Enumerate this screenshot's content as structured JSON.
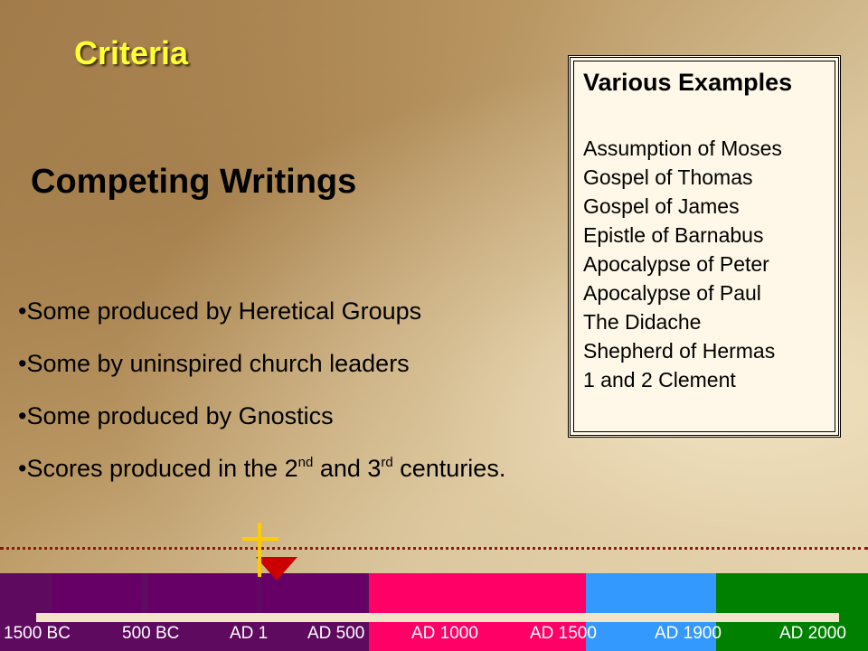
{
  "slide": {
    "title": "Criteria",
    "heading": "Competing Writings"
  },
  "bullets": [
    {
      "text": "•Some produced by Heretical Groups"
    },
    {
      "text": "•Some by uninspired church leaders"
    },
    {
      "text": "•Some produced by Gnostics"
    },
    {
      "prefix": "•Scores produced in the 2",
      "sup1": "nd",
      "mid": " and 3",
      "sup2": "rd",
      "suffix": " centuries."
    }
  ],
  "examples": {
    "title": "Various Examples",
    "items": [
      "Assumption of Moses",
      "Gospel of Thomas",
      "Gospel of James",
      "Epistle of Barnabus",
      "Apocalypse of Peter",
      "Apocalypse of Paul",
      "The Didache",
      "Shepherd of Hermas",
      "1 and 2 Clement"
    ]
  },
  "timeline": {
    "labels": [
      "1500 BC",
      "500 BC",
      "AD 1",
      "AD 500",
      "AD 1000",
      "AD 1500",
      "AD 1900",
      "AD 2000"
    ],
    "colors": {
      "purple_dark": "#5e0a5e",
      "purple": "#660066",
      "pink": "#ff0066",
      "blue": "#3399ff",
      "green": "#008000",
      "marker_cross": "#ffcc00",
      "marker_arrow": "#cc0000",
      "dotted_line": "#8b1a10"
    }
  }
}
